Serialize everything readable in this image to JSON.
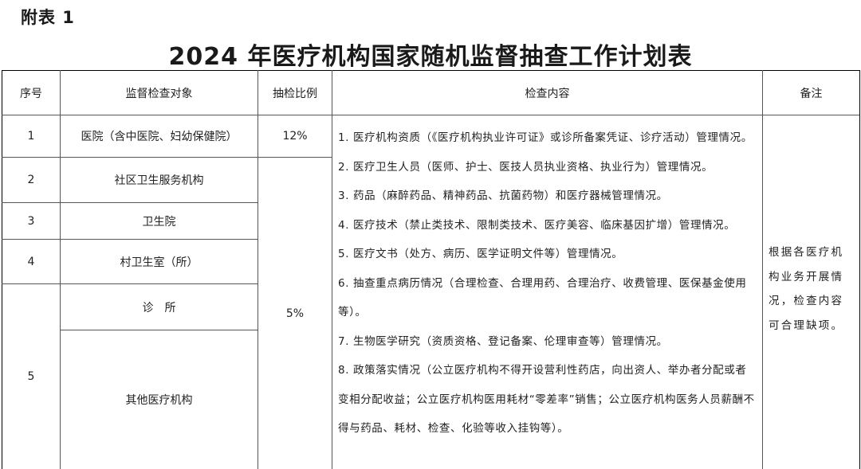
{
  "appendix_label": "附表 1",
  "title": "2024 年医疗机构国家随机监督抽查工作计划表",
  "table": {
    "headers": {
      "no": "序号",
      "target": "监督检查对象",
      "ratio": "抽检比例",
      "content": "检查内容",
      "remark": "备注"
    },
    "rows": [
      {
        "no": "1",
        "target": "医院（含中医院、妇幼保健院）"
      },
      {
        "no": "2",
        "target": "社区卫生服务机构"
      },
      {
        "no": "3",
        "target": "卫生院"
      },
      {
        "no": "4",
        "target": "村卫生室（所）"
      },
      {
        "no": "5",
        "target": "诊　所"
      },
      {
        "target": "其他医疗机构"
      }
    ],
    "ratios": [
      "12%",
      "5%"
    ],
    "content_items": [
      "1. 医疗机构资质（《医疗机构执业许可证》或诊所备案凭证、诊疗活动）管理情况。",
      "2. 医疗卫生人员（医师、护士、医技人员执业资格、执业行为）管理情况。",
      "3. 药品（麻醉药品、精神药品、抗菌药物）和医疗器械管理情况。",
      "4. 医疗技术（禁止类技术、限制类技术、医疗美容、临床基因扩增）管理情况。",
      "5. 医疗文书（处方、病历、医学证明文件等）管理情况。",
      "6. 抽查重点病历情况（合理检查、合理用药、合理治疗、收费管理、医保基金使用等）。",
      "7. 生物医学研究（资质资格、登记备案、伦理审查等）管理情况。",
      "8. 政策落实情况（公立医疗机构不得开设营利性药店，向出资人、举办者分配或者变相分配收益；公立医疗机构医用耗材“零差率”销售；公立医疗机构医务人员薪酬不得与药品、耗材、检查、化验等收入挂钩等）。"
    ],
    "remark": "根据各医疗机构业务开展情况，检查内容可合理缺项。"
  }
}
